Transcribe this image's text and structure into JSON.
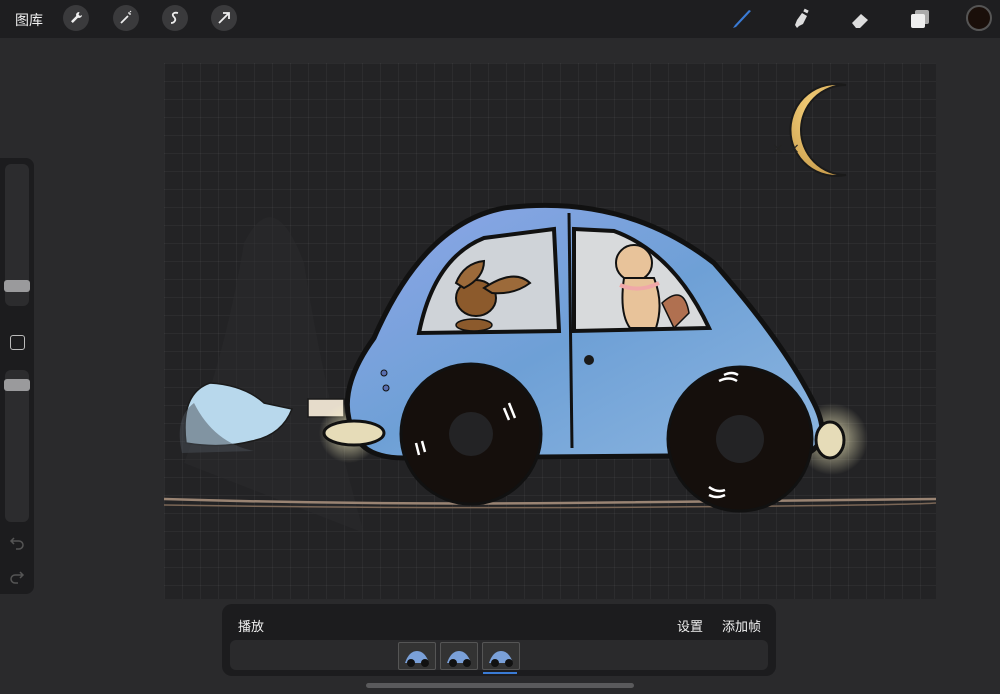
{
  "toolbar": {
    "gallery_label": "图库",
    "left_tools": [
      "wrench-icon",
      "magic-wand-icon",
      "selection-icon",
      "transform-arrow-icon"
    ],
    "right_tools": [
      "brush-icon",
      "smudge-icon",
      "eraser-icon",
      "layers-icon"
    ],
    "active_color": "#1a0f0a",
    "accent": "#3a7bd5"
  },
  "sidebar": {
    "controls": [
      "brush-size-slider",
      "modify-button",
      "opacity-slider",
      "undo-icon",
      "redo-icon"
    ]
  },
  "animation": {
    "play_label": "播放",
    "settings_label": "设置",
    "add_frame_label": "添加帧",
    "frame_count": 3,
    "selected_frame": 3
  }
}
